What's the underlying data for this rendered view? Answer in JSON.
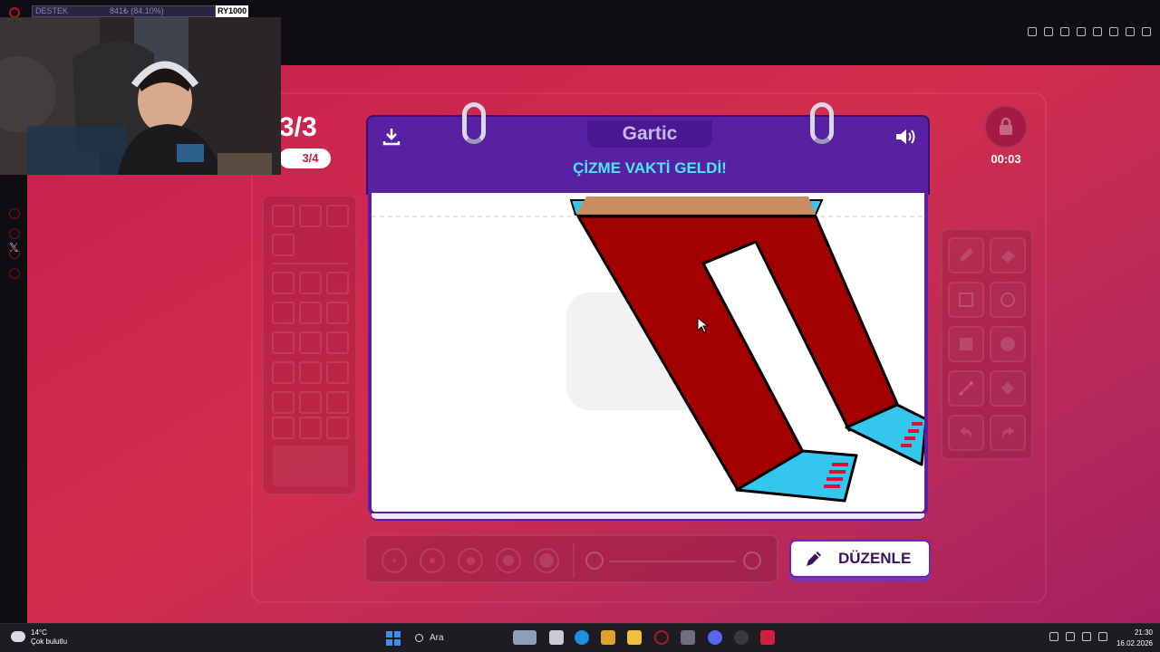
{
  "stream_overlay": {
    "stat_label": "DESTEK",
    "stat_value": "841₺ (84.10%)",
    "stat_tag": "RY1000"
  },
  "game": {
    "round": "3/3",
    "subround": "3/4",
    "logo": "Gartic",
    "title": "ÇİZME VAKTİ GELDİ!",
    "timer": "00:03",
    "edit_button": "DÜZENLE",
    "tools": [
      "pencil-icon",
      "eraser-icon",
      "rect-outline-icon",
      "circle-outline-icon",
      "rect-fill-icon",
      "circle-fill-icon",
      "line-icon",
      "fill-bucket-icon",
      "undo-icon",
      "redo-icon"
    ],
    "colors": {
      "background": "#c71f4f",
      "header": "#5820a3",
      "title": "#49e8f0",
      "pants": "#a30000",
      "shoes": "#35c6ee",
      "waistband": "#c98c5e"
    }
  },
  "taskbar": {
    "weather_temp": "14°C",
    "weather_desc": "Çok bulutlu",
    "search": "Ara",
    "time": "21:30",
    "date": "16.02.2026"
  }
}
